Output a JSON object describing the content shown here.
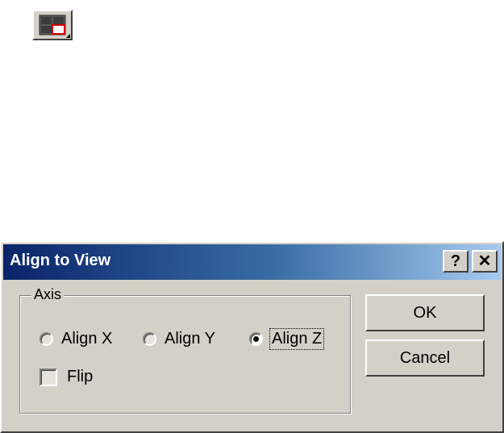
{
  "toolbar": {
    "icon": "align-to-view-icon"
  },
  "dialog": {
    "title": "Align to View",
    "help_button": "?",
    "close_button": "✕",
    "group": {
      "label": "Axis",
      "radios": [
        {
          "label": "Align X",
          "selected": false
        },
        {
          "label": "Align Y",
          "selected": false
        },
        {
          "label": "Align Z",
          "selected": true
        }
      ],
      "checkbox": {
        "label": "Flip",
        "checked": false
      }
    },
    "buttons": {
      "ok": "OK",
      "cancel": "Cancel"
    }
  },
  "colors": {
    "title_gradient_start": "#0a246a",
    "title_gradient_end": "#a6caf0",
    "face": "#d4d0c8"
  }
}
